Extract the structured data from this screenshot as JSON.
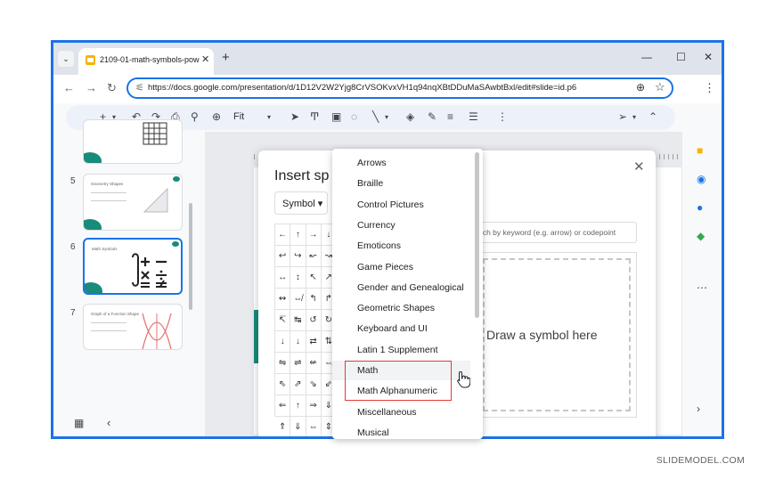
{
  "browser": {
    "tab_title": "2109-01-math-symbols-powerp",
    "tab_close": "✕",
    "new_tab": "+",
    "url": "https://docs.google.com/presentation/d/1D12V2W2Yjg8CrVSOKvxVH1q94nqXBtDDuMaSAwbtBxl/edit#slide=id.p6",
    "win_min": "—",
    "win_max": "☐",
    "win_close": "✕",
    "menu_kebab": "⋮"
  },
  "toolbar": {
    "zoom_label": "Fit"
  },
  "slides": [
    {
      "number": "",
      "title": ""
    },
    {
      "number": "5",
      "title": "Geometry Shapes"
    },
    {
      "number": "6",
      "title": "Math Symbols"
    },
    {
      "number": "7",
      "title": "Graph of a Function Shape"
    }
  ],
  "dialog": {
    "title": "Insert sp",
    "category": "Symbol",
    "search_placeholder": "rch by keyword (e.g. arrow) or codepoint",
    "draw_hint": "Draw a symbol here",
    "symbols": [
      "←",
      "↑",
      "→",
      "↓",
      "↩",
      "↪",
      "↜",
      "↝",
      "↔",
      "↕",
      "↖",
      "↗",
      "↭",
      "⇎",
      "↰",
      "↱",
      "↸",
      "↹",
      "↺",
      "↻",
      "↓",
      "↓",
      "⇄",
      "⇅",
      "⇋",
      "⇌",
      "⇍",
      "⇎",
      "⇖",
      "⇗",
      "⇘",
      "⇙",
      "⇐",
      "↑",
      "⇒",
      "⇓",
      "⇑",
      "⇓",
      "⇔",
      "⇕",
      "⇤",
      "⇥",
      "⇶",
      "⇷",
      "→",
      "↦",
      "→",
      "⇸"
    ]
  },
  "dropdown": {
    "items": [
      "Arrows",
      "Braille",
      "Control Pictures",
      "Currency",
      "Emoticons",
      "Game Pieces",
      "Gender and Genealogical",
      "Geometric Shapes",
      "Keyboard and UI",
      "Latin 1 Supplement",
      "Math",
      "Math Alphanumeric",
      "Miscellaneous",
      "Musical"
    ],
    "hovered": "Math"
  },
  "footer": {
    "brand": "SLIDEMODEL.COM"
  },
  "colors": {
    "accent": "#1a73e8",
    "highlight_box": "#e53935",
    "slide_teal": "#188b7b"
  }
}
